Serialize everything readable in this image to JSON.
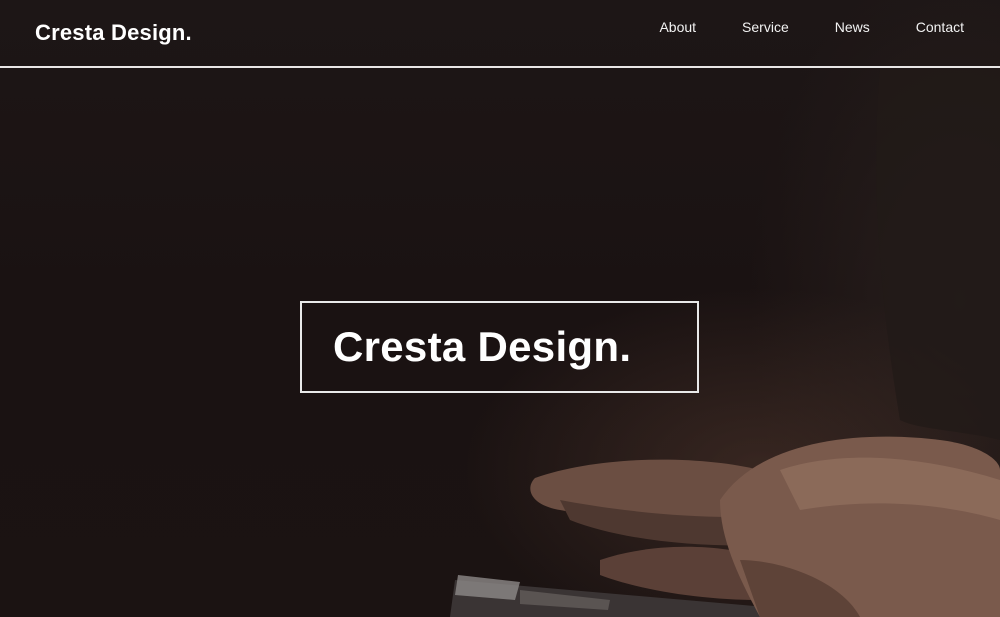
{
  "header": {
    "logo": "Cresta Design."
  },
  "nav": {
    "items": [
      "About",
      "Service",
      "News",
      "Contact"
    ]
  },
  "hero": {
    "title": "Cresta Design."
  },
  "colors": {
    "background": "#1c1414",
    "text": "#ffffff",
    "border": "#e9e9e9"
  }
}
